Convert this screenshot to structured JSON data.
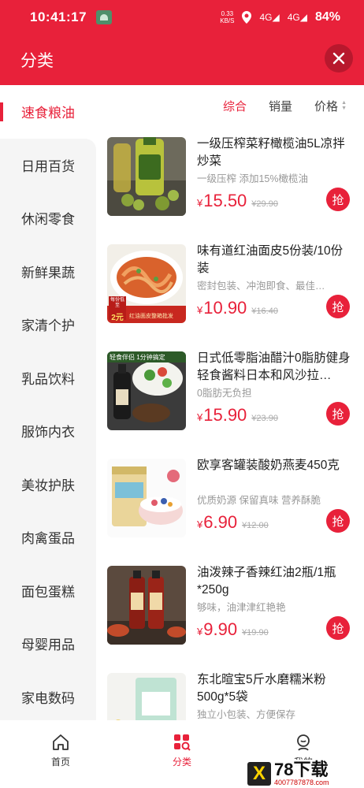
{
  "status": {
    "time": "10:41:17",
    "speed_val": "0.33",
    "speed_unit": "KB/S",
    "sig1": "4G",
    "sig2": "4G",
    "battery": "84%"
  },
  "header": {
    "title": "分类"
  },
  "sidebar": {
    "items": [
      {
        "label": "速食粮油"
      },
      {
        "label": "日用百货"
      },
      {
        "label": "休闲零食"
      },
      {
        "label": "新鲜果蔬"
      },
      {
        "label": "家清个护"
      },
      {
        "label": "乳品饮料"
      },
      {
        "label": "服饰内衣"
      },
      {
        "label": "美妆护肤"
      },
      {
        "label": "肉禽蛋品"
      },
      {
        "label": "面包蛋糕"
      },
      {
        "label": "母婴用品"
      },
      {
        "label": "家电数码"
      }
    ]
  },
  "sort": {
    "comprehensive": "综合",
    "sales": "销量",
    "price": "价格"
  },
  "products": [
    {
      "name": "一级压榨菜籽橄榄油5L凉拌炒菜",
      "sub": "一级压榨 添加15%橄榄油",
      "currency": "¥",
      "price": "15.50",
      "old": "¥29.90",
      "buy": "抢"
    },
    {
      "name": "味有道红油面皮5份装/10份装",
      "sub": "密封包装、冲泡即食、最佳…",
      "currency": "¥",
      "price": "10.90",
      "old": "¥16.40",
      "buy": "抢"
    },
    {
      "name": "日式低零脂油醋汁0脂肪健身轻食酱料日本和风沙拉…",
      "sub": "0脂肪无负担",
      "currency": "¥",
      "price": "15.90",
      "old": "¥23.90",
      "buy": "抢"
    },
    {
      "name": "欧享客罐装酸奶燕麦450克",
      "sub": "优质奶源 保留真味 营养酥脆",
      "currency": "¥",
      "price": "6.90",
      "old": "¥12.00",
      "buy": "抢"
    },
    {
      "name": "油泼辣子香辣红油2瓶/1瓶*250g",
      "sub": "够味，油津津红艳艳",
      "currency": "¥",
      "price": "9.90",
      "old": "¥19.90",
      "buy": "抢"
    },
    {
      "name": "东北暄宝5斤水磨糯米粉500g*5袋",
      "sub": "独立小包装、方便保存",
      "currency": "¥",
      "price": "",
      "old": "",
      "buy": ""
    }
  ],
  "thumb_text": {
    "p2_tag1": "每份低至",
    "p2_tag2": "2元",
    "p2_tag3": "红油面皮整箱批发",
    "p3_banner": "轻食伴侣 1分钟搞定"
  },
  "tabs": [
    {
      "label": "首页"
    },
    {
      "label": "分类"
    },
    {
      "label": "我的"
    }
  ],
  "watermark": {
    "logo": "X",
    "name": "78下载",
    "url": "4007787878.com"
  },
  "colors": {
    "brand": "#e8213a"
  }
}
